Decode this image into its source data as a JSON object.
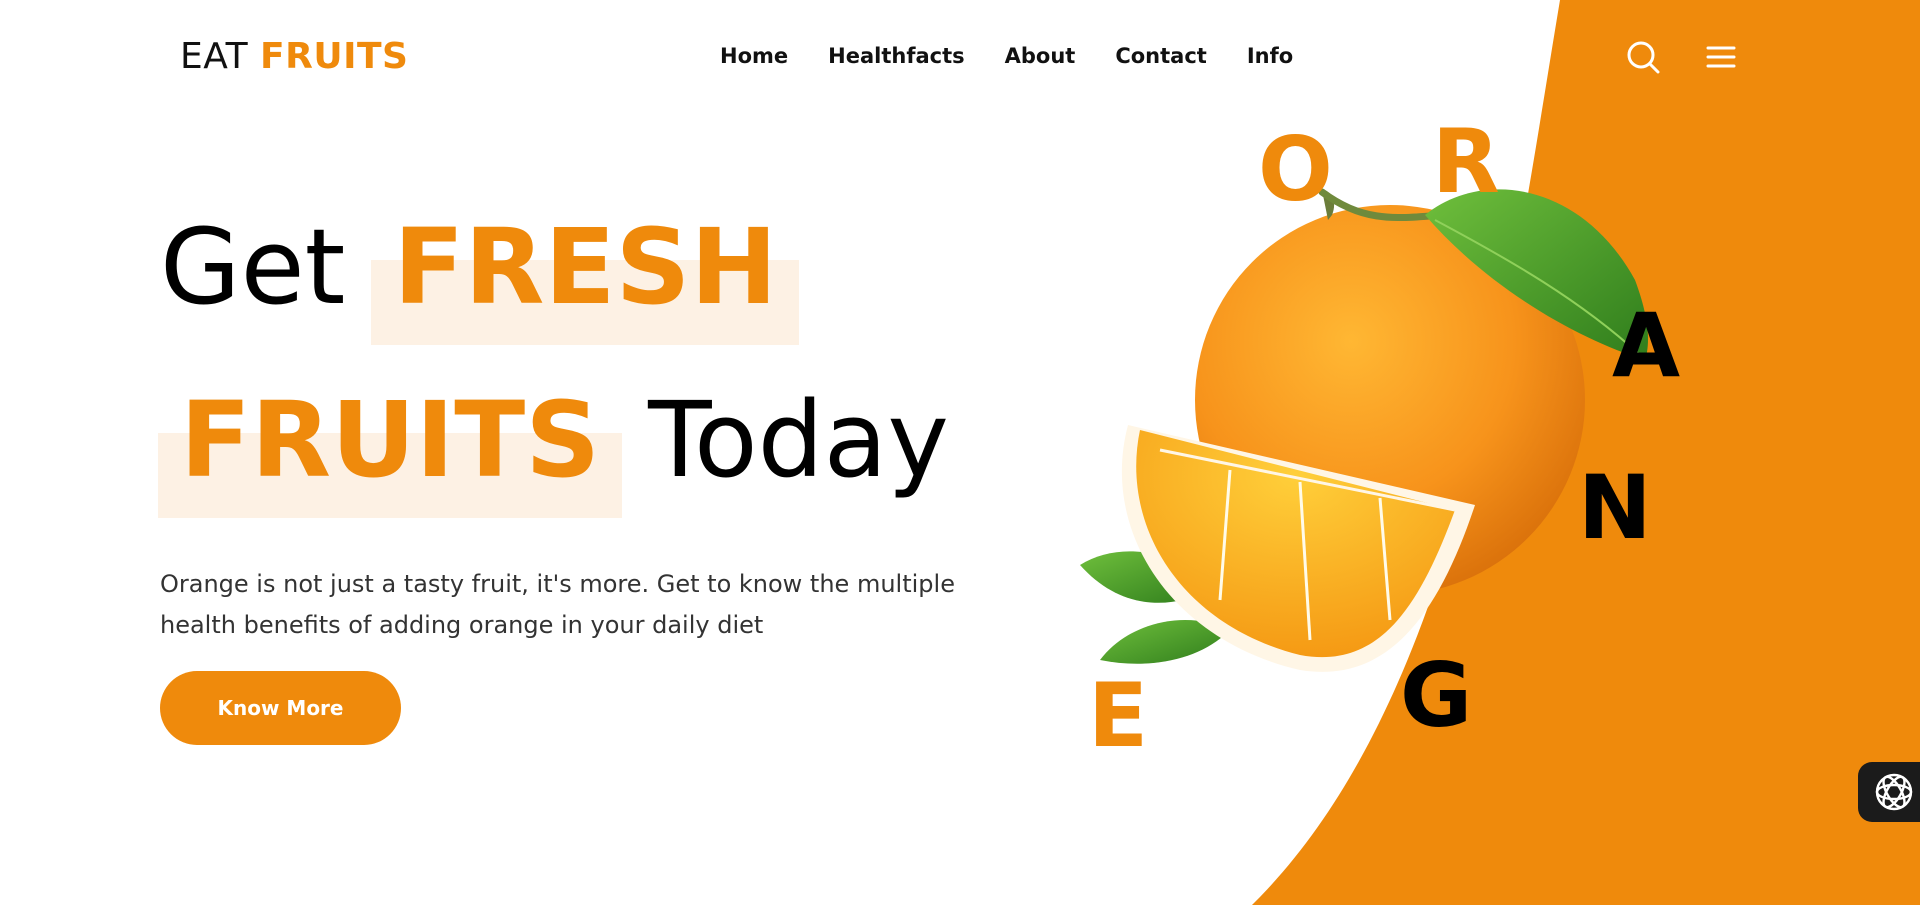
{
  "header": {
    "logo_primary": "EAT",
    "logo_accent": "FRUITS",
    "nav": [
      {
        "label": "Home"
      },
      {
        "label": "Healthfacts"
      },
      {
        "label": "About"
      },
      {
        "label": "Contact"
      },
      {
        "label": "Info"
      }
    ],
    "icons": {
      "search": "search-icon",
      "menu": "hamburger-menu-icon"
    }
  },
  "hero": {
    "line1_plain": "Get",
    "line1_highlight": "FRESH",
    "line2_highlight": "FRUITS",
    "line2_plain": "Today",
    "description": "Orange is not just a tasty fruit, it's more. Get to know the multiple health benefits of adding orange in your daily diet",
    "cta_label": "Know More"
  },
  "decorative_letters": {
    "o": "O",
    "r": "R",
    "a": "A",
    "n": "N",
    "g": "G",
    "e": "E"
  },
  "widget": {
    "icon": "assistant-widget-icon"
  },
  "colors": {
    "accent": "#ef8a0c",
    "highlight_bg": "#fdf1e4",
    "text_dark": "#111111",
    "widget_bg": "#1b1b1b"
  }
}
